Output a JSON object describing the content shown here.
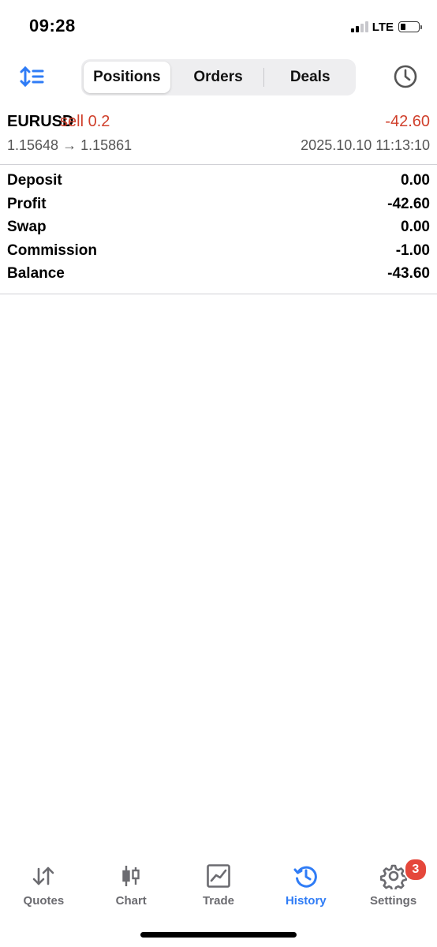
{
  "status_bar": {
    "time": "09:28",
    "network": "LTE"
  },
  "header": {
    "tabs": [
      {
        "label": "Positions",
        "active": true
      },
      {
        "label": "Orders",
        "active": false
      },
      {
        "label": "Deals",
        "active": false
      }
    ],
    "sort_icon": "sort-lines-icon",
    "history_icon": "clock-icon"
  },
  "position": {
    "symbol": "EURUSD",
    "side": "sell 0.2",
    "profit": "-42.60",
    "prices": "1.15648 → 1.15861",
    "time": "2025.10.10 11:13:10"
  },
  "summary": [
    {
      "label": "Deposit",
      "value": "0.00"
    },
    {
      "label": "Profit",
      "value": "-42.60"
    },
    {
      "label": "Swap",
      "value": "0.00"
    },
    {
      "label": "Commission",
      "value": "-1.00"
    },
    {
      "label": "Balance",
      "value": "-43.60"
    }
  ],
  "tabbar": [
    {
      "label": "Quotes",
      "icon": "quotes-arrows-icon"
    },
    {
      "label": "Chart",
      "icon": "candlestick-icon"
    },
    {
      "label": "Trade",
      "icon": "trade-chart-icon"
    },
    {
      "label": "History",
      "icon": "history-icon",
      "active": true
    },
    {
      "label": "Settings",
      "icon": "gear-icon",
      "badge": "3"
    }
  ],
  "colors": {
    "accent": "#2f7cf6",
    "loss": "#d0402c",
    "badge": "#e5473b"
  }
}
